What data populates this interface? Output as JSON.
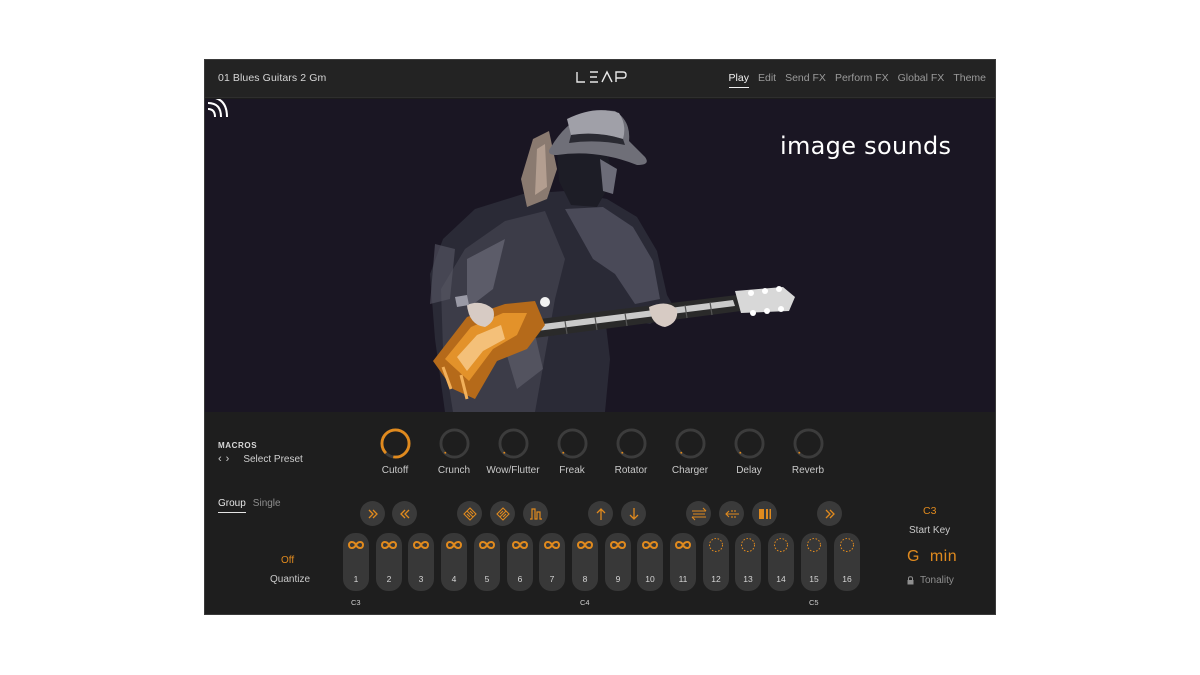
{
  "header": {
    "preset_name": "01 Blues Guitars 2 Gm",
    "logo": "LEAP",
    "tabs": [
      {
        "label": "Play",
        "active": true
      },
      {
        "label": "Edit",
        "active": false
      },
      {
        "label": "Send FX",
        "active": false
      },
      {
        "label": "Perform FX",
        "active": false
      },
      {
        "label": "Global FX",
        "active": false
      },
      {
        "label": "Theme",
        "active": false
      }
    ]
  },
  "artwork": {
    "brand": "image sounds",
    "brand_icon": "signal-waves-icon",
    "subject": "guitarist-illustration"
  },
  "macros": {
    "title": "MACROS",
    "select_preset": "Select Preset",
    "knobs": [
      {
        "label": "Cutoff",
        "value": 0.9
      },
      {
        "label": "Crunch",
        "value": 0.0
      },
      {
        "label": "Wow/Flutter",
        "value": 0.0
      },
      {
        "label": "Freak",
        "value": 0.0
      },
      {
        "label": "Rotator",
        "value": 0.0
      },
      {
        "label": "Charger",
        "value": 0.0
      },
      {
        "label": "Delay",
        "value": 0.0
      },
      {
        "label": "Reverb",
        "value": 0.0
      }
    ]
  },
  "mode_tabs": [
    {
      "label": "Group",
      "active": true
    },
    {
      "label": "Single",
      "active": false
    }
  ],
  "quantize": {
    "value": "Off",
    "label": "Quantize"
  },
  "perform_fx_icons": [
    "fast-forward-icon",
    "rewind-icon",
    "diffuse-icon",
    "diffuse-alt-icon",
    "gate-icon",
    "pitch-up-icon",
    "pitch-down-icon",
    "stretch-icon",
    "reverse-icon",
    "stutter-icon",
    "skip-forward-icon"
  ],
  "keys": [
    {
      "number": "1",
      "state": "loop"
    },
    {
      "number": "2",
      "state": "loop"
    },
    {
      "number": "3",
      "state": "loop"
    },
    {
      "number": "4",
      "state": "loop"
    },
    {
      "number": "5",
      "state": "loop"
    },
    {
      "number": "6",
      "state": "loop"
    },
    {
      "number": "7",
      "state": "loop"
    },
    {
      "number": "8",
      "state": "loop"
    },
    {
      "number": "9",
      "state": "loop"
    },
    {
      "number": "10",
      "state": "loop"
    },
    {
      "number": "11",
      "state": "loop"
    },
    {
      "number": "12",
      "state": "oneshot"
    },
    {
      "number": "13",
      "state": "oneshot"
    },
    {
      "number": "14",
      "state": "oneshot"
    },
    {
      "number": "15",
      "state": "oneshot"
    },
    {
      "number": "16",
      "state": "oneshot"
    }
  ],
  "octave_labels": [
    "C3",
    "C4",
    "C5"
  ],
  "start_key": {
    "value": "C3",
    "label": "Start Key"
  },
  "tonality": {
    "value": "G  min",
    "label": "Tonality",
    "icon": "lock-icon"
  },
  "colors": {
    "accent": "#e08a1e",
    "background": "#1e1e1e",
    "button": "#3a3a3a"
  }
}
